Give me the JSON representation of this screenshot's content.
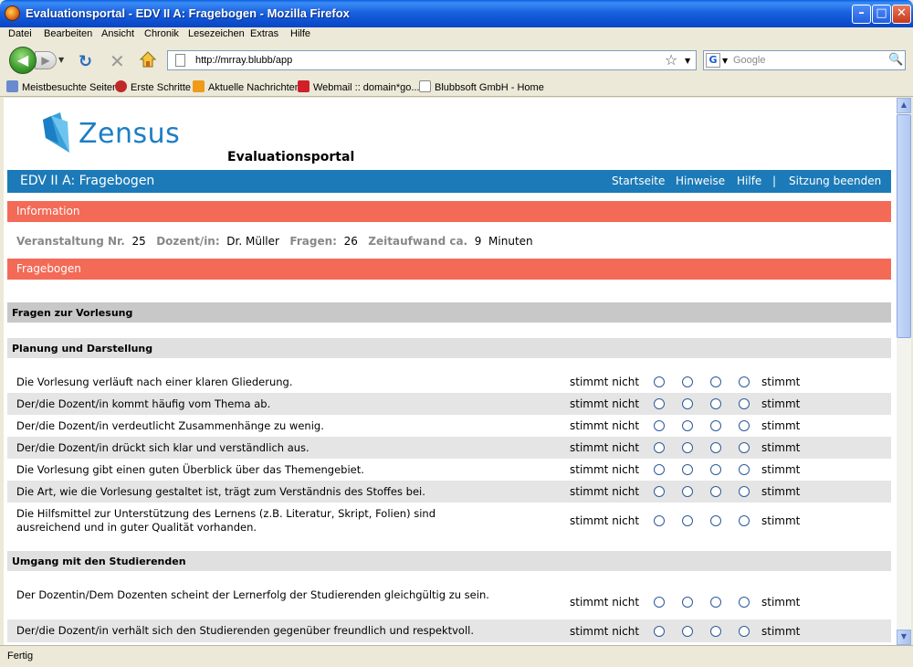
{
  "window": {
    "title": "Evaluationsportal - EDV II A: Fragebogen - Mozilla Firefox"
  },
  "menu": [
    "Datei",
    "Bearbeiten",
    "Ansicht",
    "Chronik",
    "Lesezeichen",
    "Extras",
    "Hilfe"
  ],
  "urlbar": {
    "url": "http://mrray.blubb/app"
  },
  "search": {
    "placeholder": "Google"
  },
  "bookmarks": [
    "Meistbesuchte Seiten",
    "Erste Schritte",
    "Aktuelle Nachrichten",
    "Webmail :: domain*go...",
    "Blubbsoft GmbH - Home"
  ],
  "status": "Fertig",
  "page": {
    "logo_text": "Zensus",
    "portal_title": "Evaluationsportal",
    "header_title": "EDV II A: Fragebogen",
    "nav": {
      "home": "Startseite",
      "hints": "Hinweise",
      "help": "Hilfe",
      "sep": "|",
      "logout": "Sitzung beenden"
    },
    "info_title": "Information",
    "info": {
      "course_label": "Veranstaltung Nr.",
      "course_value": "25",
      "lecturer_label": "Dozent/in:",
      "lecturer_value": "Dr. Müller",
      "questions_label": "Fragen:",
      "questions_value": "26",
      "time_label": "Zeitaufwand ca.",
      "time_value": "9",
      "time_unit": "Minuten"
    },
    "form_title": "Fragebogen",
    "section_main": "Fragen zur Vorlesung",
    "subsection1": "Planung und Darstellung",
    "subsection2": "Umgang mit den Studierenden",
    "scale_left": "stimmt nicht",
    "scale_right": "stimmt",
    "questions1": [
      "Die Vorlesung verläuft nach einer klaren Gliederung.",
      "Der/die Dozent/in kommt häufig vom Thema ab.",
      "Der/die Dozent/in verdeutlicht Zusammenhänge zu wenig.",
      "Der/die Dozent/in drückt sich klar und verständlich aus.",
      "Die Vorlesung gibt einen guten Überblick über das Themengebiet.",
      "Die Art, wie die Vorlesung gestaltet ist, trägt zum Verständnis des Stoffes bei.",
      "Die Hilfsmittel zur Unterstützung des Lernens (z.B. Literatur, Skript, Folien) sind ausreichend und in guter Qualität vorhanden."
    ],
    "questions2": [
      "Der Dozentin/Dem Dozenten scheint der Lernerfolg der Studierenden gleichgültig zu sein.",
      "Der/die Dozent/in verhält sich den Studierenden gegenüber freundlich und respektvoll."
    ]
  }
}
